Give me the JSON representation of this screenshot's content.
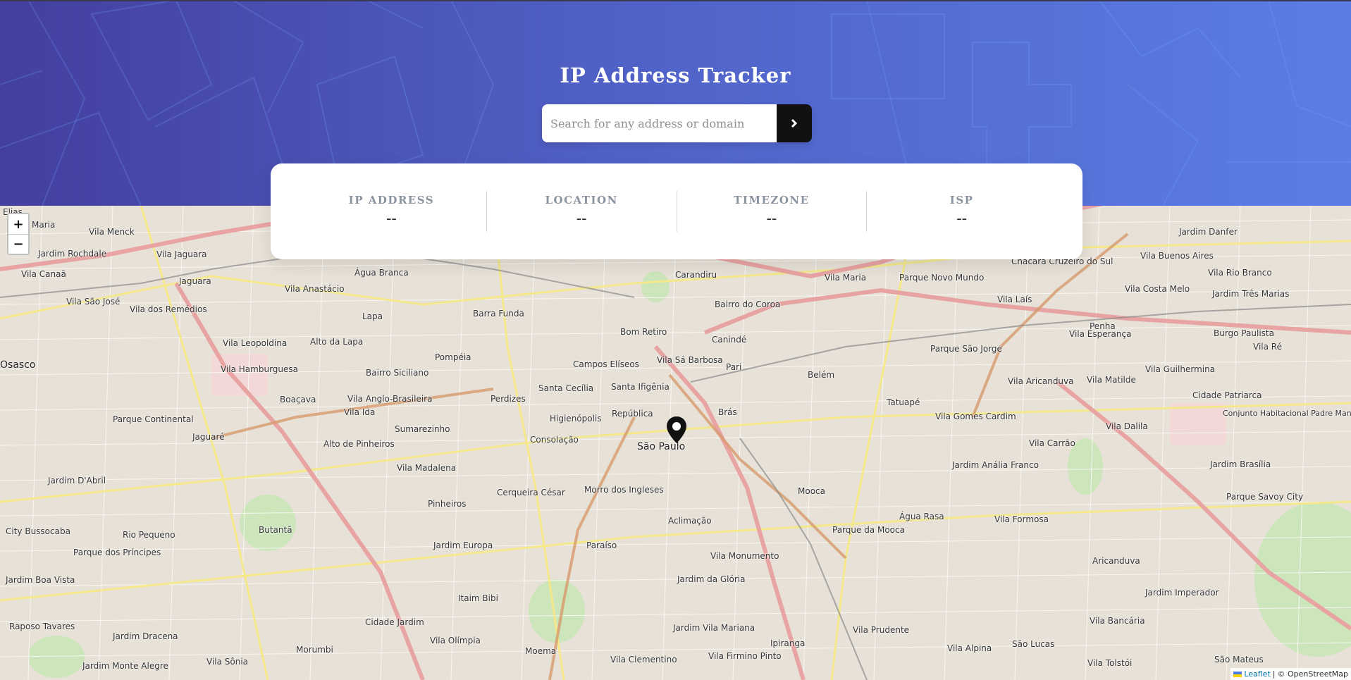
{
  "app": {
    "title": "IP Address Tracker"
  },
  "search": {
    "placeholder": "Search for any address or domain",
    "value": "",
    "submit_icon": "chevron-right-icon"
  },
  "info": [
    {
      "label": "IP ADDRESS",
      "value": "--"
    },
    {
      "label": "LOCATION",
      "value": "--"
    },
    {
      "label": "TIMEZONE",
      "value": "--"
    },
    {
      "label": "ISP",
      "value": "--"
    }
  ],
  "map": {
    "zoom_in": "+",
    "zoom_out": "−",
    "marker_icon": "map-pin-icon",
    "attribution": {
      "leaflet": "Leaflet",
      "separator": "|",
      "osm": "© OpenStreetMap"
    },
    "labels": [
      "Elias",
      "Maria",
      "Vila Menck",
      "Jardim Rochdale",
      "Vila Jaguara",
      "Vila Canaã",
      "Jaguara",
      "Vila São José",
      "Vila dos Remédios",
      "Vila Anastácio",
      "Água Branca",
      "Carandiru",
      "Vila Maria",
      "Parque Novo Mundo",
      "Chacara Cruzeiro do Sul",
      "Vila Buenos Aires",
      "Vila Rio Branco",
      "Jardim Danfer",
      "Vila Costa Melo",
      "Jardim Três Marias",
      "Lapa",
      "Barra Funda",
      "Bairro do Coroa",
      "Vila Laís",
      "Penha",
      "Vila Esperança",
      "Burgo Paulista",
      "Vila Leopoldina",
      "Alto da Lapa",
      "Bom Retiro",
      "Canindé",
      "Parque São Jorge",
      "Vila Ré",
      "Osasco",
      "Vila Hamburguesa",
      "Bairro Siciliano",
      "Pompéia",
      "Campos Elíseos",
      "Vila Sá Barbosa",
      "Pari",
      "Belém",
      "Vila Aricanduva",
      "Vila Matilde",
      "Vila Guilhermina",
      "Boaçava",
      "Vila Anglo-Brasileira",
      "Perdizes",
      "Santa Cecília",
      "Santa Ifigênia",
      "Tatuapé",
      "Cidade Patriarca",
      "Parque Continental",
      "Vila Ida",
      "Sumarezinho",
      "Higienópolis",
      "República",
      "Brás",
      "Vila Gomes Cardim",
      "Vila Dalila",
      "Jaguaré",
      "Alto de Pinheiros",
      "Consolação",
      "São Paulo",
      "Vila Carrão",
      "Jardim Brasília",
      "Vila Madalena",
      "Jardim Anália Franco",
      "Jardim D'Abril",
      "Cerqueira César",
      "Morro dos Ingleses",
      "Mooca",
      "Parque Savoy City",
      "Pinheiros",
      "Aclimação",
      "Água Rasa",
      "Vila Formosa",
      "City Bussocaba",
      "Butantã",
      "Parque da Mooca",
      "Rio Pequeno",
      "Jardim Europa",
      "Paraíso",
      "Vila Monumento",
      "Aricanduva",
      "Parque dos Príncipes",
      "Jardim da Glória",
      "Jardim Imperador",
      "Jardim Boa Vista",
      "Itaim Bibi",
      "Vila Prudente",
      "Vila Bancária",
      "Cidade Jardim",
      "Raposo Tavares",
      "Jardim Dracena",
      "Vila Olímpia",
      "Jardim Vila Mariana",
      "Ipiranga",
      "Vila Alpina",
      "São Lucas",
      "Vila Sônia",
      "Morumbi",
      "Moema",
      "Vila Clementino",
      "Vila Firmino Pinto",
      "Vila Tolstói",
      "São Mateus",
      "Jardim Monte Alegre",
      "Conjunto Habitacional Padre Manoel da Nóbrega"
    ]
  }
}
